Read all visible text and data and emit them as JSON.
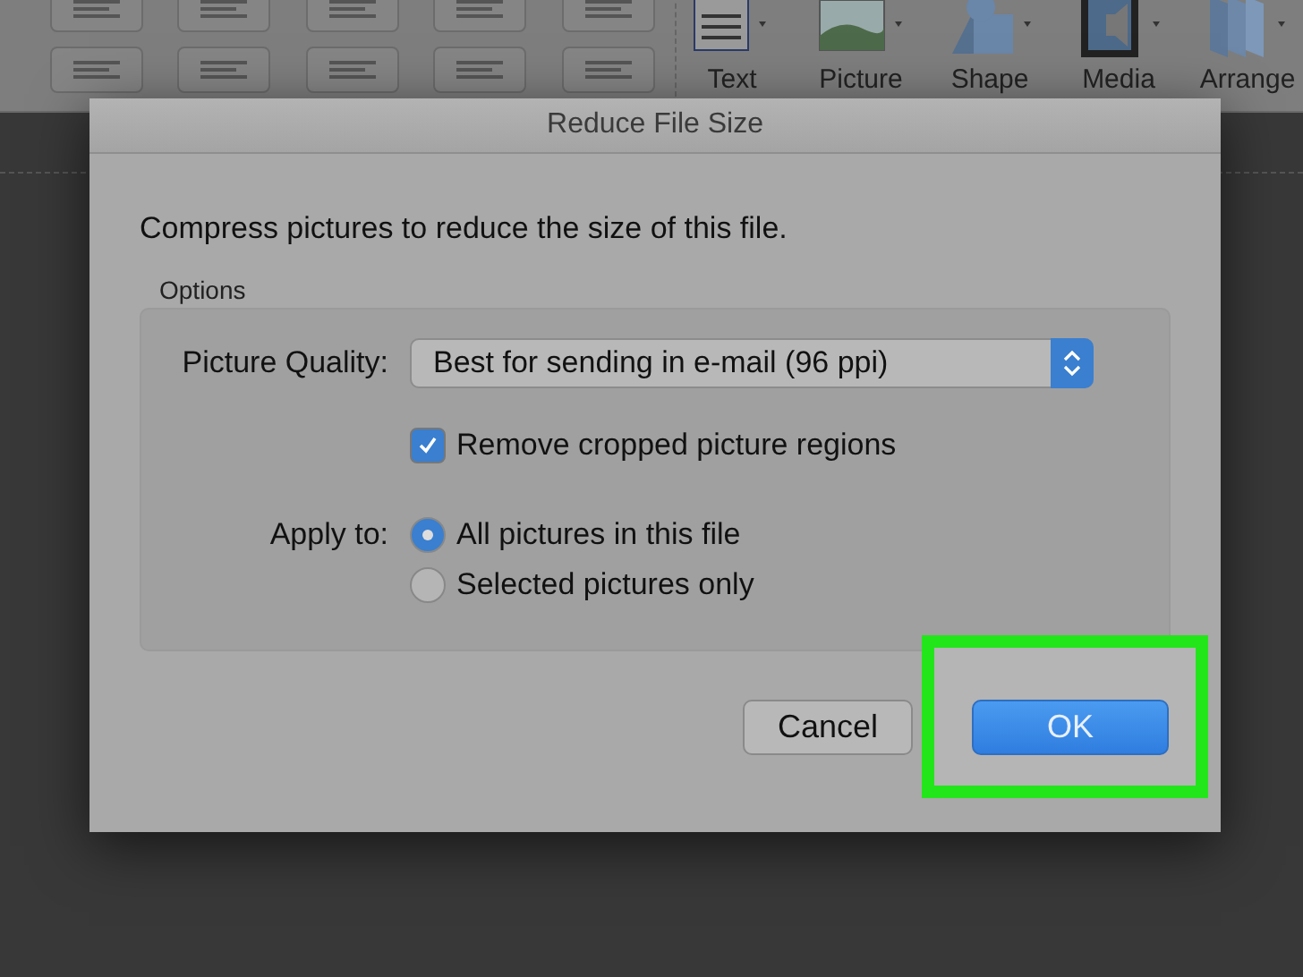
{
  "ribbon": {
    "tools": [
      {
        "kind": "text",
        "label": "Text"
      },
      {
        "kind": "picture",
        "label": "Picture"
      },
      {
        "kind": "shape",
        "label": "Shape"
      },
      {
        "kind": "media",
        "label": "Media"
      },
      {
        "kind": "arrange",
        "label": "Arrange"
      }
    ]
  },
  "dialog": {
    "title": "Reduce File Size",
    "message": "Compress pictures to reduce the size of this file.",
    "group_label": "Options",
    "quality": {
      "label": "Picture Quality:",
      "value": "Best for sending in e-mail (96 ppi)"
    },
    "remove_cropped": {
      "label": "Remove cropped picture regions",
      "checked": true
    },
    "apply_to": {
      "label": "Apply to:",
      "options": [
        {
          "label": "All pictures in this file",
          "selected": true
        },
        {
          "label": "Selected pictures only",
          "selected": false
        }
      ]
    },
    "buttons": [
      {
        "kind": "secondary",
        "label": "Cancel",
        "highlighted": false
      },
      {
        "kind": "primary",
        "label": "OK",
        "highlighted": true
      }
    ]
  }
}
